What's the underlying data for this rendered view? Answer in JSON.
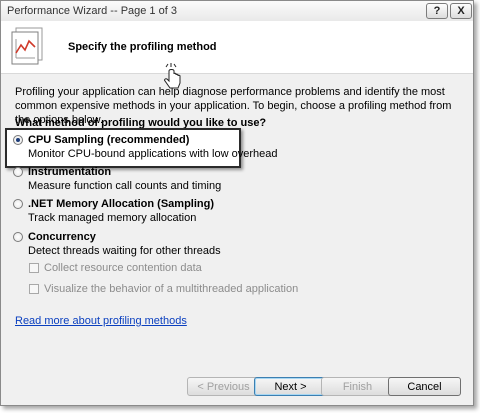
{
  "window": {
    "title": "Performance Wizard -- Page 1 of 3",
    "help_label": "?",
    "close_label": "X"
  },
  "header": {
    "title": "Specify the profiling method",
    "icon": "chart-icon"
  },
  "intro": "Profiling your application can help diagnose performance problems and identify the most common expensive methods in your application. To begin, choose a profiling method from the options below.",
  "question": "What method of profiling would you like to use?",
  "options": [
    {
      "label": "CPU Sampling (recommended)",
      "description": "Monitor CPU-bound applications with low overhead",
      "selected": true
    },
    {
      "label": "Instrumentation",
      "description": "Measure function call counts and timing",
      "selected": false
    },
    {
      "label": ".NET Memory Allocation (Sampling)",
      "description": "Track managed memory allocation",
      "selected": false
    },
    {
      "label": "Concurrency",
      "description": "Detect threads waiting for other threads",
      "selected": false
    }
  ],
  "concurrency_options": [
    {
      "label": "Collect resource contention data",
      "checked": false,
      "enabled": false
    },
    {
      "label": "Visualize the behavior of a multithreaded application",
      "checked": false,
      "enabled": false
    }
  ],
  "read_more_link": "Read more about profiling methods",
  "buttons": {
    "previous": "< Previous",
    "next": "Next >",
    "finish": "Finish",
    "cancel": "Cancel"
  }
}
